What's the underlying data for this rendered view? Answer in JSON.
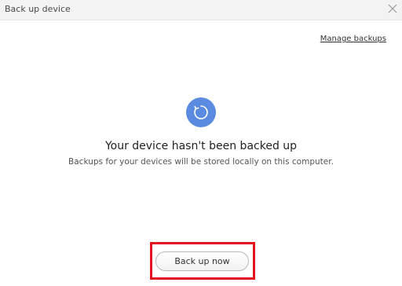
{
  "window": {
    "title": "Back up device"
  },
  "header": {
    "manage_backups_label": "Manage backups"
  },
  "main": {
    "status_icon": "sync-icon",
    "headline": "Your device hasn't been backed up",
    "subline": "Backups for your devices will be stored locally on this computer.",
    "backup_button_label": "Back up now"
  },
  "colors": {
    "accent": "#5b8be1",
    "highlight": "#e3141f"
  }
}
